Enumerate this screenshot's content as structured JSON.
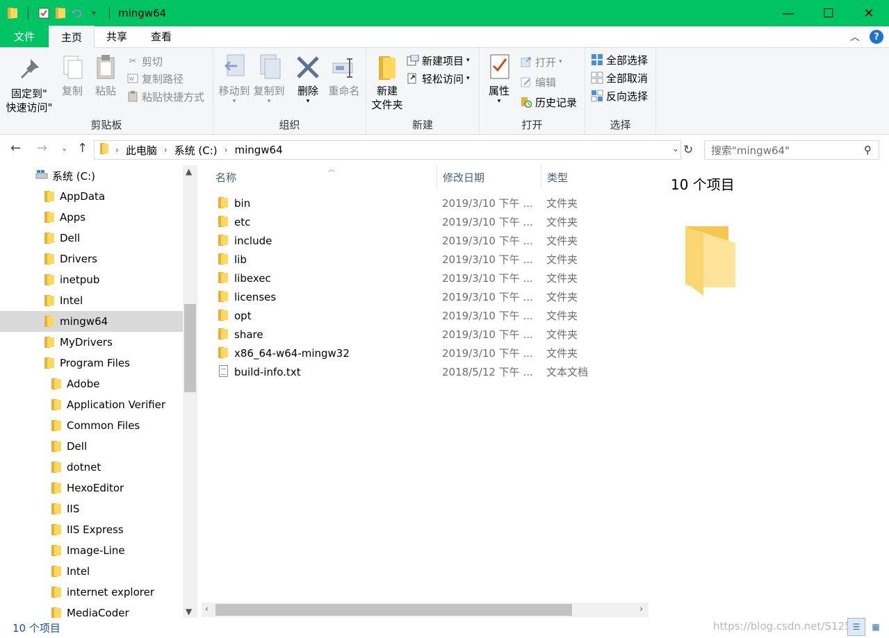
{
  "window": {
    "title": "mingw64",
    "accent": "#00c364",
    "controls": {
      "minimize": "—",
      "maximize": "☐",
      "close": "✕"
    }
  },
  "ribbon_tabs": [
    {
      "label": "文件"
    },
    {
      "label": "主页"
    },
    {
      "label": "共享"
    },
    {
      "label": "查看"
    }
  ],
  "ribbon": {
    "clipboard": {
      "label": "剪贴板",
      "pin_line1": "固定到\"",
      "pin_line2": "快速访问\"",
      "copy": "复制",
      "paste": "粘贴",
      "cut": "剪切",
      "copy_path": "复制路径",
      "paste_shortcut": "粘贴快捷方式"
    },
    "organize": {
      "label": "组织",
      "move_to": "移动到",
      "copy_to": "复制到",
      "delete": "删除",
      "rename": "重命名"
    },
    "new": {
      "label": "新建",
      "new_folder_line1": "新建",
      "new_folder_line2": "文件夹",
      "new_item": "新建项目",
      "easy_access": "轻松访问"
    },
    "open": {
      "label": "打开",
      "properties": "属性",
      "open": "打开",
      "edit": "编辑",
      "history": "历史记录"
    },
    "select": {
      "label": "选择",
      "select_all": "全部选择",
      "select_none": "全部取消",
      "invert": "反向选择"
    }
  },
  "address": {
    "crumbs": [
      "此电脑",
      "系统 (C:)",
      "mingw64"
    ]
  },
  "search": {
    "placeholder": "搜索\"mingw64\""
  },
  "sidebar": {
    "drive": "系统 (C:)",
    "items": [
      {
        "label": "AppData",
        "indent": 1
      },
      {
        "label": "Apps",
        "indent": 1
      },
      {
        "label": "Dell",
        "indent": 1
      },
      {
        "label": "Drivers",
        "indent": 1
      },
      {
        "label": "inetpub",
        "indent": 1
      },
      {
        "label": "Intel",
        "indent": 1
      },
      {
        "label": "mingw64",
        "indent": 1,
        "selected": true
      },
      {
        "label": "MyDrivers",
        "indent": 1
      },
      {
        "label": "Program Files",
        "indent": 1
      },
      {
        "label": "Adobe",
        "indent": 2
      },
      {
        "label": "Application Verifier",
        "indent": 2
      },
      {
        "label": "Common Files",
        "indent": 2
      },
      {
        "label": "Dell",
        "indent": 2
      },
      {
        "label": "dotnet",
        "indent": 2
      },
      {
        "label": "HexoEditor",
        "indent": 2
      },
      {
        "label": "IIS",
        "indent": 2
      },
      {
        "label": "IIS Express",
        "indent": 2
      },
      {
        "label": "Image-Line",
        "indent": 2
      },
      {
        "label": "Intel",
        "indent": 2
      },
      {
        "label": "internet explorer",
        "indent": 2
      },
      {
        "label": "MediaCoder",
        "indent": 2
      }
    ]
  },
  "columns": {
    "name": "名称",
    "date": "修改日期",
    "type": "类型"
  },
  "files": [
    {
      "name": "bin",
      "date": "2019/3/10 下午 ...",
      "type": "文件夹",
      "kind": "folder"
    },
    {
      "name": "etc",
      "date": "2019/3/10 下午 ...",
      "type": "文件夹",
      "kind": "folder"
    },
    {
      "name": "include",
      "date": "2019/3/10 下午 ...",
      "type": "文件夹",
      "kind": "folder"
    },
    {
      "name": "lib",
      "date": "2019/3/10 下午 ...",
      "type": "文件夹",
      "kind": "folder"
    },
    {
      "name": "libexec",
      "date": "2019/3/10 下午 ...",
      "type": "文件夹",
      "kind": "folder"
    },
    {
      "name": "licenses",
      "date": "2019/3/10 下午 ...",
      "type": "文件夹",
      "kind": "folder"
    },
    {
      "name": "opt",
      "date": "2019/3/10 下午 ...",
      "type": "文件夹",
      "kind": "folder"
    },
    {
      "name": "share",
      "date": "2019/3/10 下午 ...",
      "type": "文件夹",
      "kind": "folder"
    },
    {
      "name": "x86_64-w64-mingw32",
      "date": "2019/3/10 下午 ...",
      "type": "文件夹",
      "kind": "folder"
    },
    {
      "name": "build-info.txt",
      "date": "2018/5/12 下午 ...",
      "type": "文本文档",
      "kind": "text"
    }
  ],
  "preview": {
    "count": "10 个项目"
  },
  "status": {
    "count": "10 个项目",
    "watermark": "https://blog.csdn.net/S1259"
  }
}
